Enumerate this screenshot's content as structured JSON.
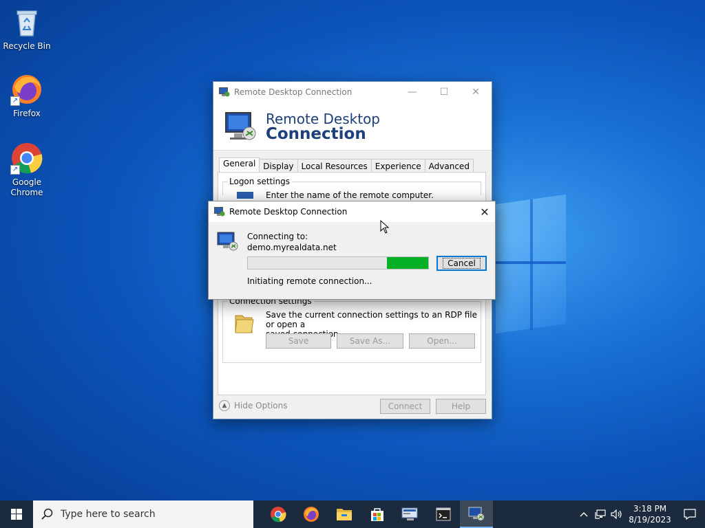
{
  "desktop": {
    "icons": [
      {
        "label": "Recycle Bin"
      },
      {
        "label": "Firefox"
      },
      {
        "label": "Google Chrome"
      }
    ]
  },
  "rdc_window": {
    "title": "Remote Desktop Connection",
    "banner_line1": "Remote Desktop",
    "banner_line2": "Connection",
    "tabs": [
      {
        "label": "General",
        "active": true
      },
      {
        "label": "Display"
      },
      {
        "label": "Local Resources"
      },
      {
        "label": "Experience"
      },
      {
        "label": "Advanced"
      }
    ],
    "logon_settings": {
      "title": "Logon settings",
      "text": "Enter the name of the remote computer."
    },
    "connection_settings": {
      "title": "Connection settings",
      "text_line1": "Save the current connection settings to an RDP file or open a",
      "text_line2": "saved connection.",
      "save_label": "Save",
      "save_as_label": "Save As...",
      "open_label": "Open..."
    },
    "hide_options_label": "Hide Options",
    "connect_label": "Connect",
    "help_label": "Help"
  },
  "connect_dialog": {
    "title": "Remote Desktop Connection",
    "connecting_to_label": "Connecting to:",
    "host": "demo.myrealdata.net",
    "progress_fraction": 0.23,
    "cancel_label": "Cancel",
    "status": "Initiating remote connection..."
  },
  "taskbar": {
    "search_placeholder": "Type here to search",
    "apps": [
      "chrome-icon",
      "firefox-icon",
      "file-explorer-icon",
      "store-icon",
      "rdp-manager-icon",
      "terminal-icon",
      "remote-desktop-icon"
    ],
    "time": "3:18 PM",
    "date": "8/19/2023"
  },
  "colors": {
    "accent": "#0078d7",
    "progress": "#06b025",
    "taskbar": "#1b2a3d"
  }
}
